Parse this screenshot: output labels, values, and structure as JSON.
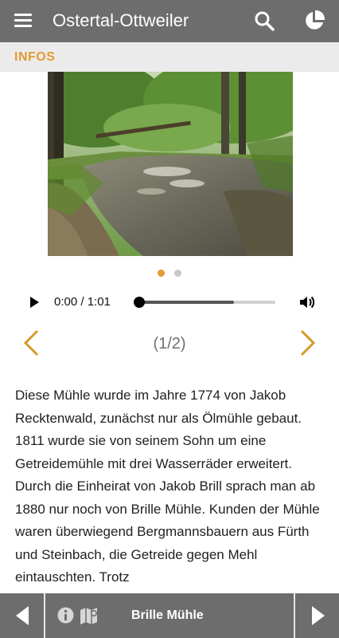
{
  "app_bar": {
    "title": "Ostertal-Ottweiler",
    "background": "#6d6d6d",
    "menu_icon": "hamburger-menu-icon",
    "search_icon": "search-icon",
    "chart_icon": "pie-chart-icon"
  },
  "section": {
    "label": "INFOS",
    "accent_color": "#e39a2f"
  },
  "gallery": {
    "image_subject": "stream in a forest",
    "active_index": 1,
    "total": 2,
    "counter_text": "(1/2)",
    "active_dot_color": "#e39a2f",
    "inactive_dot_color": "#c8c8c8"
  },
  "audio_player": {
    "time_text": "0:00 / 1:01",
    "progress": 0,
    "buffered": 0.7,
    "play_icon": "play-icon",
    "volume_icon": "volume-icon"
  },
  "description": "Diese Mühle wurde im Jahre 1774 von Jakob Recktenwald, zunächst nur als Ölmühle gebaut. 1811 wurde sie von seinem Sohn um eine Getreidemühle mit drei Wasserräder erweitert. Durch die Einheirat von Jakob Brill sprach man ab 1880 nur noch von Brille Mühle. Kunden der Mühle waren überwiegend Bergmannsbauern aus Fürth und Steinbach, die Getreide gegen Mehl eintauschten. Trotz",
  "bottom_bar": {
    "title": "Brille Mühle",
    "info_icon": "info-icon",
    "map_icon": "map-icon",
    "prev_icon": "arrow-left-icon",
    "next_icon": "arrow-right-icon"
  }
}
